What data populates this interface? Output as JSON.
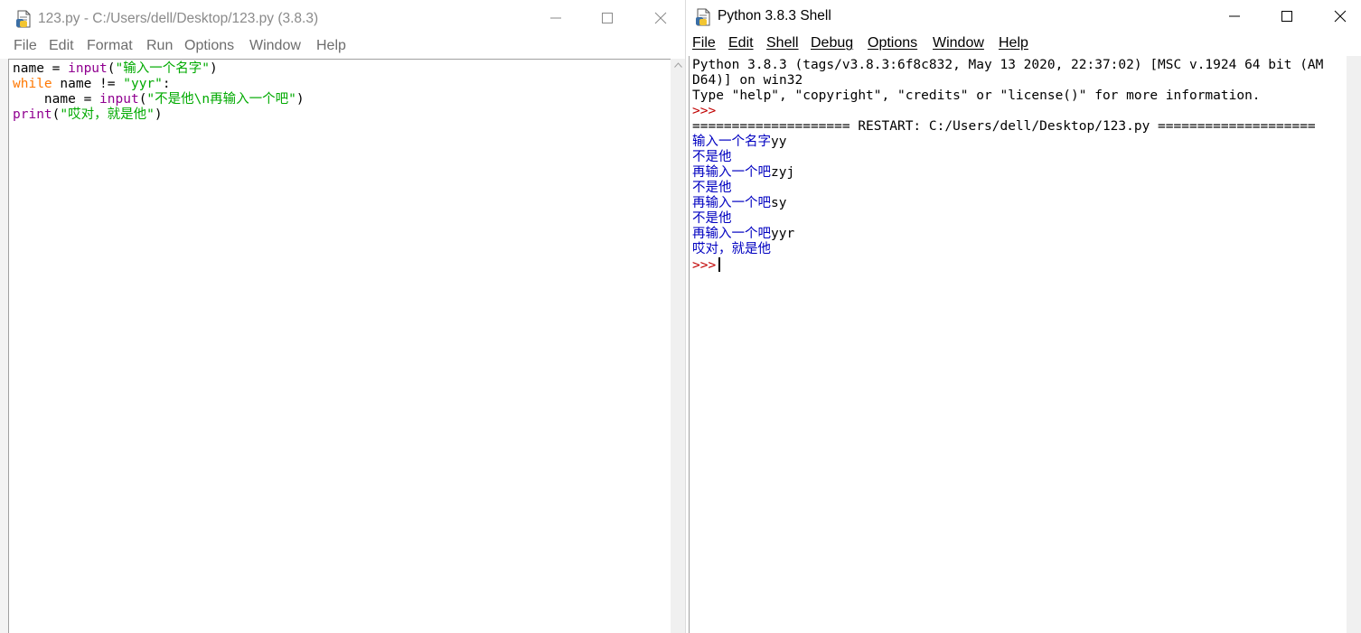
{
  "editor": {
    "title": "123.py - C:/Users/dell/Desktop/123.py (3.8.3)",
    "menu": [
      "File",
      "Edit",
      "Format",
      "Run",
      "Options",
      "Window",
      "Help"
    ],
    "code": {
      "l1": {
        "a": "name = ",
        "b": "input",
        "c": "(",
        "d": "\"输入一个名字\"",
        "e": ")"
      },
      "l2": {
        "a": "while",
        "b": " name != ",
        "c": "\"yyr\"",
        "d": ":"
      },
      "l3": {
        "a": "    name = ",
        "b": "input",
        "c": "(",
        "d": "\"不是他\\n再输入一个吧\"",
        "e": ")"
      },
      "l4": {
        "a": "print",
        "b": "(",
        "c": "\"哎对，就是他\"",
        "d": ")"
      }
    }
  },
  "shell": {
    "title": "Python 3.8.3 Shell",
    "menu": [
      "File",
      "Edit",
      "Shell",
      "Debug",
      "Options",
      "Window",
      "Help"
    ],
    "lines": [
      "Python 3.8.3 (tags/v3.8.3:6f8c832, May 13 2020, 22:37:02) [MSC v.1924 64 bit (AM",
      "D64)] on win32",
      "Type \"help\", \"copyright\", \"credits\" or \"license()\" for more information."
    ],
    "prompt": ">>>",
    "restart": "==================== RESTART: C:/Users/dell/Desktop/123.py ====================",
    "output": [
      {
        "text": "输入一个名字",
        "input": "yy"
      },
      {
        "text": "不是他",
        "input": ""
      },
      {
        "text": "再输入一个吧",
        "input": "zyj"
      },
      {
        "text": "不是他",
        "input": ""
      },
      {
        "text": "再输入一个吧",
        "input": "sy"
      },
      {
        "text": "不是他",
        "input": ""
      },
      {
        "text": "再输入一个吧",
        "input": "yyr"
      },
      {
        "text": "哎对，就是他",
        "input": ""
      }
    ],
    "final_prompt": ">>>"
  },
  "icons": {
    "app": "idle-file-icon",
    "minimize": "minimize-icon",
    "maximize": "maximize-icon",
    "close": "close-icon"
  },
  "colors": {
    "keyword": "#ff7700",
    "builtin": "#900090",
    "string": "#00aa00",
    "output": "#0000c0",
    "prompt": "#c00000"
  }
}
